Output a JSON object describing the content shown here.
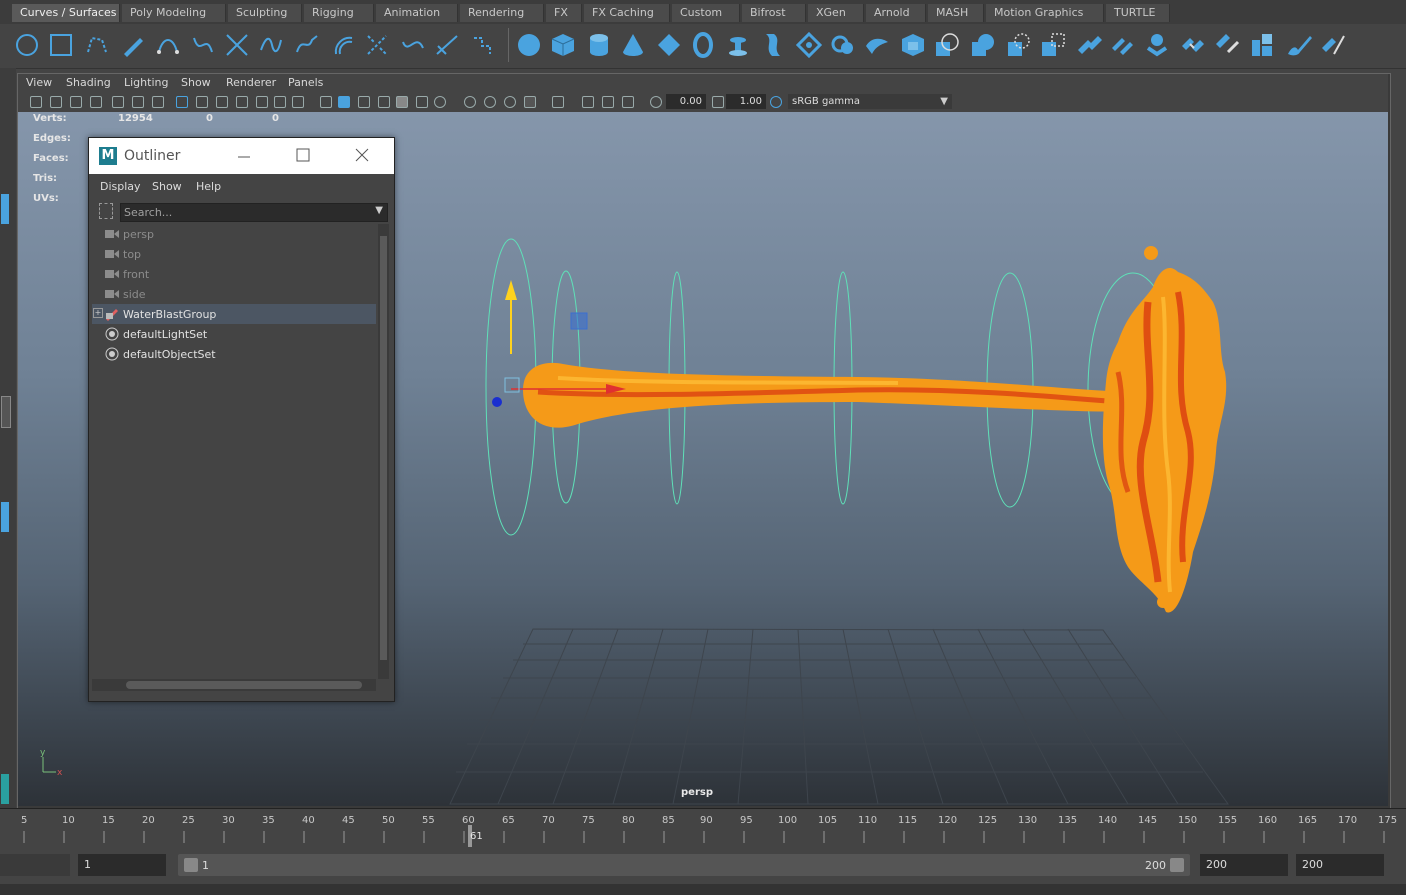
{
  "shelf_tabs": [
    "Curves / Surfaces",
    "Poly Modeling",
    "Sculpting",
    "Rigging",
    "Animation",
    "Rendering",
    "FX",
    "FX Caching",
    "Custom",
    "Bifrost",
    "XGen",
    "Arnold",
    "MASH",
    "Motion Graphics",
    "TURTLE"
  ],
  "active_shelf_tab": "Curves / Surfaces",
  "viewport_menu": [
    "View",
    "Shading",
    "Lighting",
    "Show",
    "Renderer",
    "Panels"
  ],
  "viewport_toolbar": {
    "exposure": "0.00",
    "gamma": "1.00",
    "color_space": "sRGB gamma"
  },
  "hud": {
    "labels": [
      "Verts:",
      "Edges:",
      "Faces:",
      "Tris:",
      "UVs:"
    ],
    "verts": [
      "12954",
      "0",
      "0"
    ]
  },
  "outliner": {
    "title": "Outliner",
    "menu": [
      "Display",
      "Show",
      "Help"
    ],
    "search_placeholder": "Search...",
    "items": [
      {
        "label": "persp",
        "icon": "camera-icon",
        "dim": true
      },
      {
        "label": "top",
        "icon": "camera-icon",
        "dim": true
      },
      {
        "label": "front",
        "icon": "camera-icon",
        "dim": true
      },
      {
        "label": "side",
        "icon": "camera-icon",
        "dim": true
      },
      {
        "label": "WaterBlastGroup",
        "icon": "group-icon",
        "dim": false,
        "selected": true
      },
      {
        "label": "defaultLightSet",
        "icon": "set-icon",
        "dim": false
      },
      {
        "label": "defaultObjectSet",
        "icon": "set-icon",
        "dim": false
      }
    ]
  },
  "camera_label": "persp",
  "axis": {
    "y": "y",
    "x": "x"
  },
  "timeline": {
    "ticks": [
      "5",
      "10",
      "15",
      "20",
      "25",
      "30",
      "35",
      "40",
      "45",
      "50",
      "55",
      "60",
      "65",
      "70",
      "75",
      "80",
      "85",
      "90",
      "95",
      "100",
      "105",
      "110",
      "115",
      "120",
      "125",
      "130",
      "135",
      "140",
      "145",
      "150",
      "155",
      "160",
      "165",
      "170",
      "175"
    ],
    "current_frame": "61"
  },
  "range": {
    "start": "1",
    "range_start": "1",
    "range_end": "200",
    "end_a": "200",
    "end_b": "200"
  },
  "colors": {
    "accent": "#4aa3df",
    "selection": "#4c5663",
    "fluid": "#f7a21a",
    "viewport_top": "#8596ab"
  }
}
